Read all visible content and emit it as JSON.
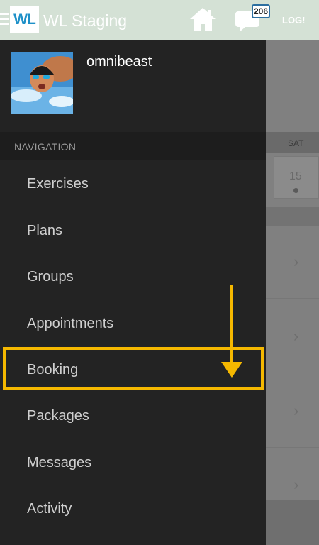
{
  "appbar": {
    "logo_text": "WL",
    "title": "WL Staging",
    "message_count": "206",
    "logout_label": "LOG!",
    "icons": [
      "menu-icon",
      "home-icon",
      "chat-bubble-icon"
    ]
  },
  "drawer": {
    "username": "omnibeast",
    "nav_header": "NAVIGATION",
    "items": [
      {
        "label": "Exercises"
      },
      {
        "label": "Plans"
      },
      {
        "label": "Groups"
      },
      {
        "label": "Appointments"
      },
      {
        "label": "Booking",
        "highlighted": true
      },
      {
        "label": "Packages"
      },
      {
        "label": "Messages"
      },
      {
        "label": "Activity"
      }
    ]
  },
  "background": {
    "day_header": "SAT",
    "day_number": "15"
  },
  "colors": {
    "appbar": "#d4e1d5",
    "drawer": "#232323",
    "annotation": "#f5b800",
    "logo_text": "#1e90c8"
  }
}
